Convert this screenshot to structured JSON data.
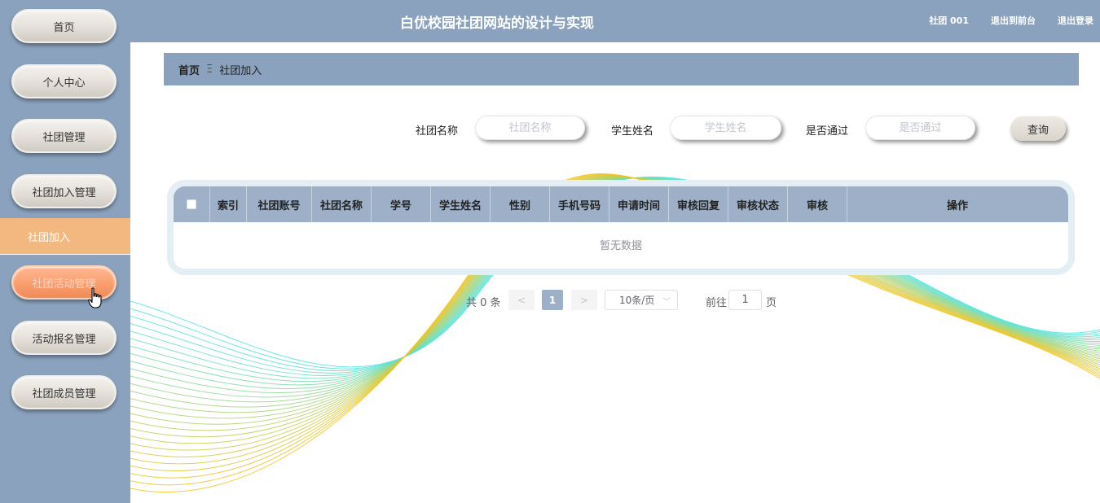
{
  "header": {
    "title": "白优校园社团网站的设计与实现",
    "user": "社团 001",
    "back_to_front": "退出到前台",
    "logout": "退出登录"
  },
  "sidebar": {
    "items": [
      {
        "label": "首页"
      },
      {
        "label": "个人中心"
      },
      {
        "label": "社团管理"
      },
      {
        "label": "社团加入管理"
      },
      {
        "label": "社团活动管理"
      },
      {
        "label": "活动报名管理"
      },
      {
        "label": "社团成员管理"
      }
    ],
    "submenu_active": "社团加入"
  },
  "breadcrumb": {
    "home": "首页",
    "separator": "Ξ",
    "current": "社团加入"
  },
  "search": {
    "club_name_label": "社团名称",
    "club_name_placeholder": "社团名称",
    "student_name_label": "学生姓名",
    "student_name_placeholder": "学生姓名",
    "approved_label": "是否通过",
    "approved_placeholder": "是否通过",
    "query_button": "查询"
  },
  "table": {
    "columns": [
      "索引",
      "社团账号",
      "社团名称",
      "学号",
      "学生姓名",
      "性别",
      "手机号码",
      "申请时间",
      "审核回复",
      "审核状态",
      "审核",
      "操作"
    ],
    "empty_text": "暂无数据"
  },
  "pagination": {
    "total": "共 0 条",
    "prev": "<",
    "current_page": "1",
    "next": ">",
    "page_size": "10条/页",
    "goto_label": "前往",
    "goto_value": "1",
    "page_suffix": "页"
  },
  "colors": {
    "primary": "#8aa2bd",
    "table_header": "#9db0c8",
    "active_menu": "#f3b780",
    "wave_cyan": "#4fe3e0",
    "wave_yellow": "#f2c41a"
  }
}
